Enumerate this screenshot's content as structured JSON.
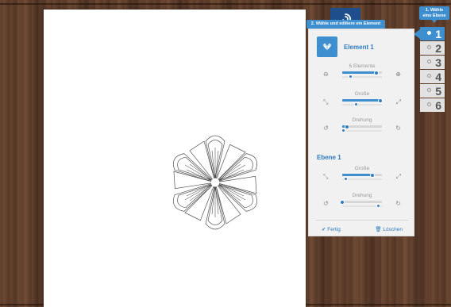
{
  "tooltips": {
    "layer_hint": "1. Wähle eine Ebene",
    "element_hint": "2. Wähle und editiere ein Element"
  },
  "layers": [
    {
      "label": "1",
      "active": true
    },
    {
      "label": "2",
      "active": false
    },
    {
      "label": "3",
      "active": false
    },
    {
      "label": "4",
      "active": false
    },
    {
      "label": "5",
      "active": false
    },
    {
      "label": "6",
      "active": false
    }
  ],
  "element_panel": {
    "title": "Element 1",
    "sliders": [
      {
        "label": "6 Elemente",
        "icon_left": "minus-circle-icon",
        "icon_right": "plus-circle-icon",
        "value": 0.85,
        "sub_value": 0.2
      },
      {
        "label": "Große",
        "icon_left": "shrink-arrows-icon",
        "icon_right": "expand-arrows-icon",
        "value": 0.95,
        "sub_value": 0.35
      },
      {
        "label": "Drehung",
        "icon_left": "rotate-left-icon",
        "icon_right": "rotate-right-icon",
        "value": 0.12,
        "sub_value": 0.02
      }
    ]
  },
  "layer_panel": {
    "title": "Ebene 1",
    "sliders": [
      {
        "label": "Große",
        "icon_left": "shrink-arrows-icon",
        "icon_right": "expand-arrows-icon",
        "value": 0.75,
        "sub_value": 0.08
      },
      {
        "label": "Drehung",
        "icon_left": "rotate-left-icon",
        "icon_right": "rotate-right-icon",
        "value": 0.0,
        "sub_value": 0.9
      }
    ]
  },
  "actions": {
    "done": "Fertig",
    "delete": "Löschen"
  },
  "colors": {
    "accent": "#3e8fd0",
    "accent_dark": "#1e4f8c"
  }
}
